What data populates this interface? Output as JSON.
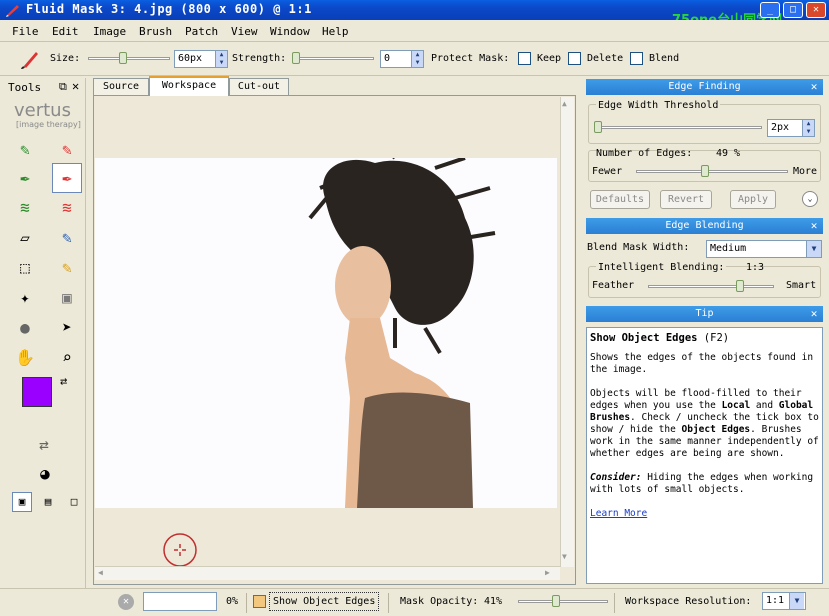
{
  "window": {
    "title": "Fluid Mask 3: 4.jpg (800 x 600) @ 1:1",
    "watermark": "75one台山同学网",
    "minimize": "_",
    "maximize": "□",
    "close": "✕"
  },
  "menu": [
    "File",
    "Edit",
    "Image",
    "Brush",
    "Patch",
    "View",
    "Window",
    "Help"
  ],
  "toolbar": {
    "size_label": "Size:",
    "size_value": "60px",
    "size_slider_level": 0.42,
    "strength_label": "Strength:",
    "strength_value": "0",
    "strength_slider_level": 0.0,
    "protect_label": "Protect Mask:",
    "keep_label": "Keep",
    "delete_label": "Delete",
    "blend_label": "Blend"
  },
  "tools_panel": {
    "title": "Tools",
    "logo_name": "vertus",
    "logo_tagline": "[image therapy]",
    "foreground_color": "#9900ff"
  },
  "tabs": [
    {
      "label": "Source",
      "active": false
    },
    {
      "label": "Workspace",
      "active": true
    },
    {
      "label": "Cut-out",
      "active": false
    }
  ],
  "edge_finding": {
    "title": "Edge Finding",
    "threshold_label": "Edge Width Threshold",
    "threshold_value": "2px",
    "num_edges_label": "Number of Edges:",
    "num_edges_value": "49 %",
    "fewer_label": "Fewer",
    "more_label": "More",
    "defaults_label": "Defaults",
    "revert_label": "Revert",
    "apply_label": "Apply"
  },
  "edge_blending": {
    "title": "Edge Blending",
    "blend_width_label": "Blend Mask Width:",
    "blend_width_value": "Medium",
    "intelligent_label": "Intelligent Blending:",
    "intelligent_value": "1:3",
    "feather_label": "Feather",
    "smart_label": "Smart"
  },
  "tip": {
    "title": "Tip",
    "heading": "Show Object Edges",
    "shortcut": "(F2)",
    "p1": "Shows the edges of the objects found in the image.",
    "p2a": "Objects will be flood-filled to their edges when you use the ",
    "p2b": "Local",
    "p2c": " and ",
    "p2d": "Global Brushes",
    "p2e": ". Check / uncheck the tick box to show / hide the ",
    "p2f": "Object Edges",
    "p2g": ". Brushes work in the same manner independently of whether edges are being are shown.",
    "consider_label": "Consider:",
    "consider_text": " Hiding the edges when working with lots of small objects.",
    "learn_more": "Learn More"
  },
  "status": {
    "progress_text": "0%",
    "show_edges_label": "Show Object Edges",
    "mask_opacity_label": "Mask Opacity:",
    "mask_opacity_value": "41%",
    "mask_opacity_level": 0.41,
    "resolution_label": "Workspace Resolution:",
    "resolution_value": "1:1"
  }
}
